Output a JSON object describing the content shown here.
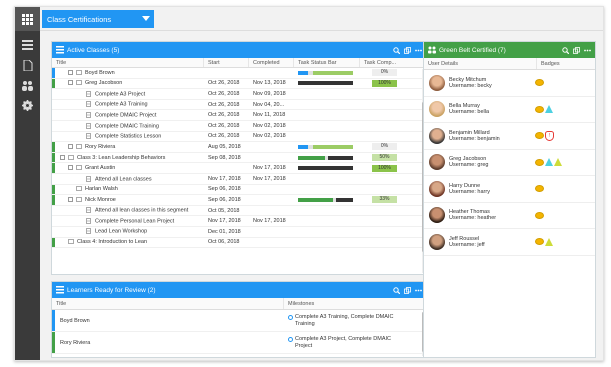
{
  "topbar": {
    "title": "Class Certifications"
  },
  "active_classes": {
    "title": "Active Classes (5)",
    "columns": [
      "Title",
      "Start",
      "Completed",
      "Task Status Bar",
      "Task Comp..."
    ],
    "rows": [
      {
        "title": "Boyd Brown",
        "start": "",
        "completed": "",
        "pct": "0%"
      },
      {
        "title": "Greg Jacobson",
        "start": "Oct 26, 2018",
        "completed": "Nov 13, 2018",
        "pct": "100%"
      },
      {
        "title": "Complete A3 Project",
        "start": "Oct 26, 2018",
        "completed": "Nov 09, 2018",
        "pct": ""
      },
      {
        "title": "Complete A3 Training",
        "start": "Oct 26, 2018",
        "completed": "Nov 04, 20...",
        "pct": ""
      },
      {
        "title": "Complete DMAIC Project",
        "start": "Oct 26, 2018",
        "completed": "Nov 11, 2018",
        "pct": ""
      },
      {
        "title": "Complete DMAIC Training",
        "start": "Oct 26, 2018",
        "completed": "Nov 02, 2018",
        "pct": ""
      },
      {
        "title": "Complete Statistics Lesson",
        "start": "Oct 26, 2018",
        "completed": "Nov 02, 2018",
        "pct": ""
      },
      {
        "title": "Rory Riviera",
        "start": "Aug 05, 2018",
        "completed": "",
        "pct": "0%"
      },
      {
        "title": "Class 3: Lean Leadership Behaviors",
        "start": "Sep 08, 2018",
        "completed": "",
        "pct": "50%"
      },
      {
        "title": "Grant Austin",
        "start": "",
        "completed": "Nov 17, 2018",
        "pct": "100%"
      },
      {
        "title": "Attend all Lean classes",
        "start": "Nov 17, 2018",
        "completed": "Nov 17, 2018",
        "pct": ""
      },
      {
        "title": "Harlan Walsh",
        "start": "Sep 06, 2018",
        "completed": "",
        "pct": ""
      },
      {
        "title": "Nick Monroe",
        "start": "Sep 06, 2018",
        "completed": "",
        "pct": "33%"
      },
      {
        "title": "Attend all lean classes in this segment",
        "start": "Oct 05, 2018",
        "completed": "",
        "pct": ""
      },
      {
        "title": "Complete Personal Lean Project",
        "start": "Nov 17, 2018",
        "completed": "Nov 17, 2018",
        "pct": ""
      },
      {
        "title": "Lead Lean Workshop",
        "start": "Dec 01, 2018",
        "completed": "",
        "pct": ""
      },
      {
        "title": "Class 4: Introduction to Lean",
        "start": "Oct 06, 2018",
        "completed": "",
        "pct": ""
      }
    ]
  },
  "review": {
    "title": "Learners Ready for Review (2)",
    "columns": [
      "Title",
      "Milestones"
    ],
    "rows": [
      {
        "title": "Boyd Brown",
        "milestone": "Complete A3 Training, Complete DMAIC Training"
      },
      {
        "title": "Rory Riviera",
        "milestone": "Complete A3 Project, Complete DMAIC Project"
      }
    ]
  },
  "green_belt": {
    "title": "Green Belt Certified (7)",
    "columns": [
      "User Details",
      "Badges"
    ],
    "username_prefix": "Username:",
    "users": [
      {
        "name": "Becky Mitchum",
        "username": "Username: becky"
      },
      {
        "name": "Bella Murray",
        "username": "Username: bella"
      },
      {
        "name": "Benjamin Millard",
        "username": "Username: benjamin"
      },
      {
        "name": "Greg Jacobson",
        "username": "Username: greg"
      },
      {
        "name": "Harry Dunne",
        "username": "Username: harry"
      },
      {
        "name": "Heather Thomas",
        "username": "Username: heather"
      },
      {
        "name": "Jeff Roussel",
        "username": "Username: jeff"
      }
    ]
  },
  "colors": {
    "accent": "#2196f3",
    "green": "#43a047",
    "sidebar": "#3a3a3a"
  }
}
